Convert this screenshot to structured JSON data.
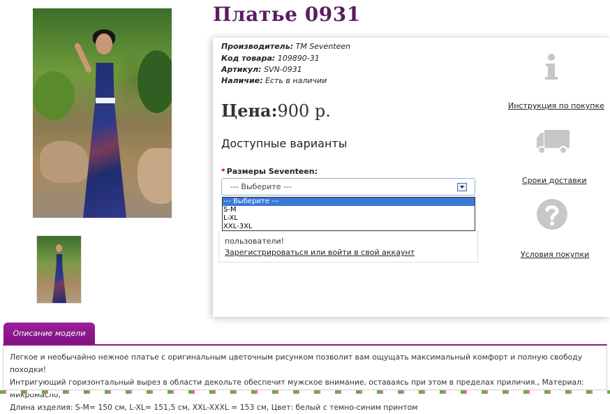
{
  "product": {
    "title": "Платье 0931",
    "manufacturer_label": "Производитель:",
    "manufacturer_value": "TM Seventeen",
    "code_label": "Код товара:",
    "code_value": "109890-31",
    "article_label": "Артикул:",
    "article_value": "SVN-0931",
    "stock_label": "Наличие:",
    "stock_value": "Есть в наличии",
    "price_label": "Цена:",
    "price_value": "900 р."
  },
  "variants": {
    "heading": "Доступные варианты",
    "required_mark": "*",
    "size_label": "Размеры Seventeen:",
    "select_value": "--- Выберите ---",
    "options": [
      "--- Выберите ---",
      "S-M",
      "L-XL",
      "XXL-3XL"
    ]
  },
  "login": {
    "text": "пользователи!",
    "link": "Зарегистрироваться или войти в свой аккаунт"
  },
  "side": {
    "instruction_link": "Инструкция по покупке",
    "delivery_link": "Сроки доставки",
    "conditions_link": "Условия покупки",
    "info_icon": "info-icon",
    "truck_icon": "truck-icon",
    "question_icon": "question-icon"
  },
  "description": {
    "tab_label": "Описание модели",
    "line1": "Легкое и необычайно нежное платье с оригинальным цветочным рисунком позволит вам ощущать максимальный комфорт и полную свободу походки!",
    "line2": "Интригующий горизонтальный вырез в области декольте обеспечит мужское внимание, оставаясь при этом в пределах приличия., Материал: микромасло,",
    "line3": "Длина изделия: S-M= 150 см, L-XL= 151,5 см, XXL-XXXL = 153 см, Цвет: белый с темно-синим принтом"
  },
  "colors": {
    "title": "#5a1d5e",
    "tab": "#8a1a8a",
    "dropdown_selected": "#3a78d8",
    "required": "#cc0000"
  }
}
